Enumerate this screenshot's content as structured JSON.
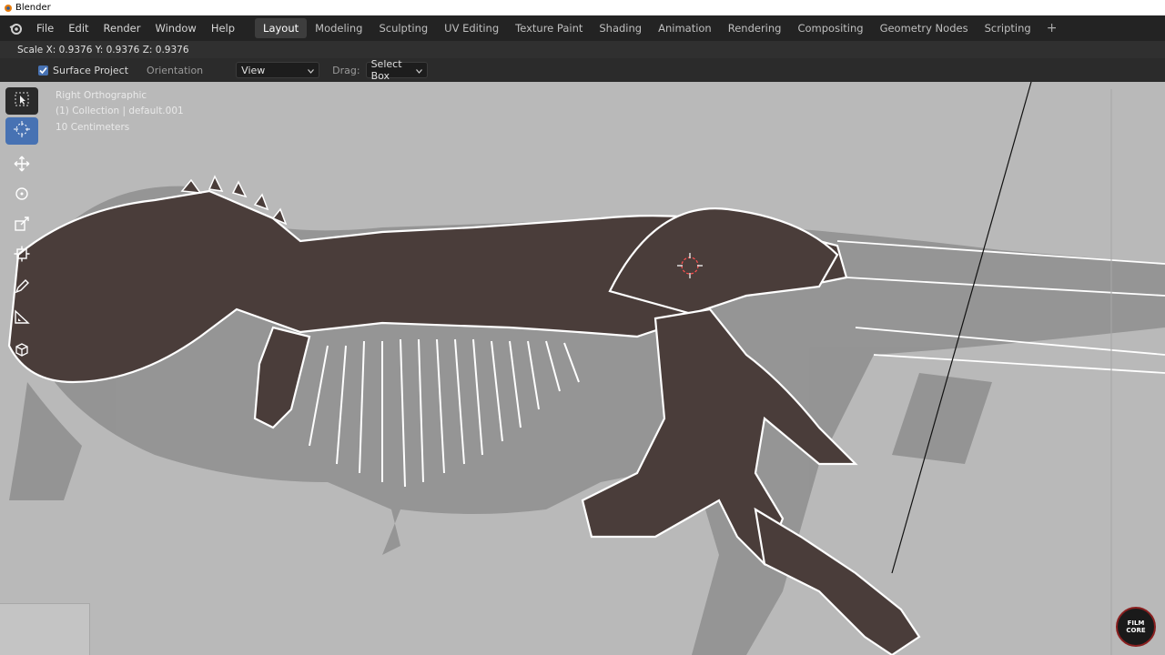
{
  "window": {
    "title": "Blender"
  },
  "menu": {
    "items": [
      "File",
      "Edit",
      "Render",
      "Window",
      "Help"
    ]
  },
  "workspaces": {
    "tabs": [
      "Layout",
      "Modeling",
      "Sculpting",
      "UV Editing",
      "Texture Paint",
      "Shading",
      "Animation",
      "Rendering",
      "Compositing",
      "Geometry Nodes",
      "Scripting"
    ],
    "active": "Layout",
    "add": "+"
  },
  "status": {
    "scale": "Scale X: 0.9376   Y: 0.9376   Z: 0.9376"
  },
  "tool_options": {
    "surface_project": "Surface Project",
    "surface_project_checked": true,
    "orientation_label": "Orientation",
    "orientation_value": "View",
    "drag_label": "Drag:",
    "drag_value": "Select Box"
  },
  "viewport": {
    "view_name": "Right Orthographic",
    "collection": "(1) Collection | default.001",
    "scale_unit": "10 Centimeters"
  },
  "toolbar": {
    "tools": [
      "select-box-icon",
      "cursor-icon",
      "move-icon",
      "rotate-icon",
      "scale-icon",
      "transform-icon",
      "annotate-icon",
      "measure-icon",
      "add-cube-icon"
    ],
    "active": "cursor-icon"
  },
  "badge": {
    "line1": "FILM",
    "line2": "CORE"
  },
  "colors": {
    "accent": "#4772b3",
    "viewport_bg": "#b9b9b9",
    "header_bg": "#232323"
  }
}
